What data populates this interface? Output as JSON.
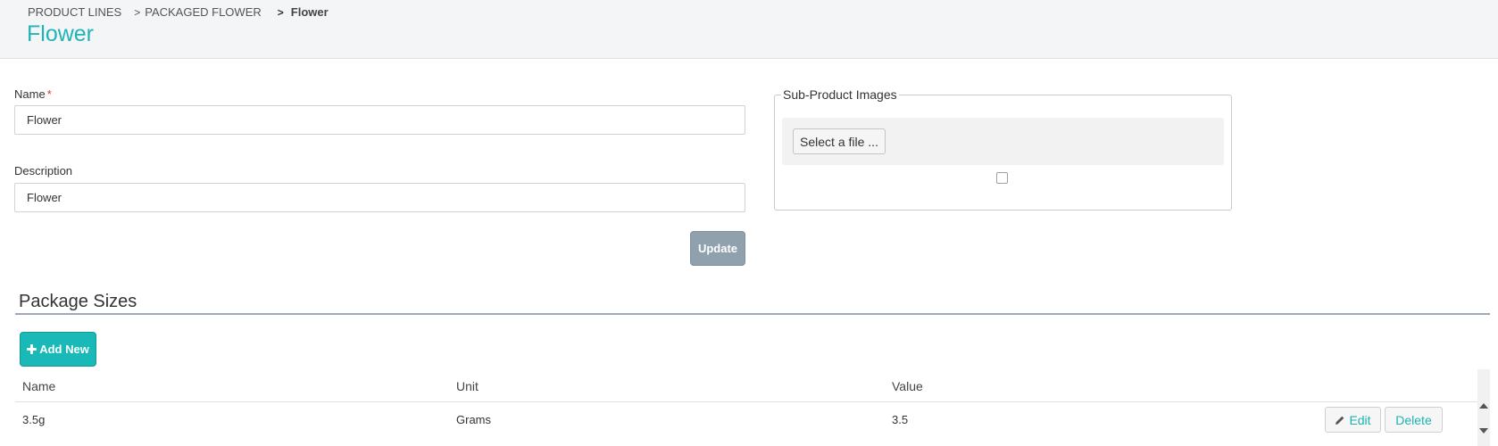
{
  "breadcrumb": {
    "items": [
      "PRODUCT LINES",
      "PACKAGED FLOWER",
      "Flower"
    ],
    "separator": ">"
  },
  "page": {
    "title": "Flower"
  },
  "form": {
    "name_label": "Name",
    "required_mark": "*",
    "name_value": "Flower",
    "description_label": "Description",
    "description_value": "Flower",
    "update_label": "Update"
  },
  "images": {
    "legend": "Sub-Product Images",
    "select_file_label": "Select a file ..."
  },
  "package_sizes": {
    "title": "Package Sizes",
    "add_label": "Add New",
    "columns": [
      "Name",
      "Unit",
      "Value"
    ],
    "rows": [
      {
        "name": "3.5g",
        "unit": "Grams",
        "value": "3.5",
        "edit_label": "Edit",
        "delete_label": "Delete"
      }
    ]
  },
  "icons": {
    "add": "plus-icon",
    "edit": "pencil-icon"
  },
  "colors": {
    "accent": "#22b3b6",
    "add_button": "#18b9b6",
    "update_button": "#8fa1ac",
    "required": "#d9333f"
  }
}
